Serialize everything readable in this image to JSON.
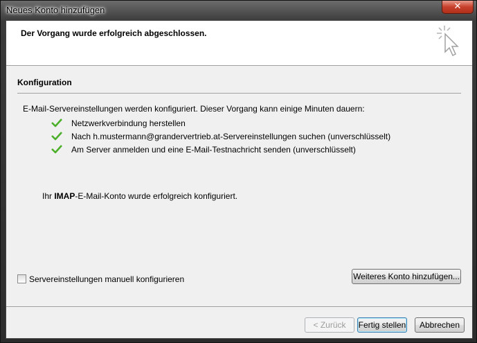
{
  "window": {
    "title": "Neues Konto hinzufügen",
    "close_label": "✕"
  },
  "header": {
    "message": "Der Vorgang wurde erfolgreich abgeschlossen."
  },
  "section": {
    "title": "Konfiguration"
  },
  "description": "E-Mail-Servereinstellungen werden konfiguriert. Dieser Vorgang kann einige Minuten dauern:",
  "steps": [
    {
      "label": "Netzwerkverbindung herstellen",
      "status": "done"
    },
    {
      "label": "Nach h.mustermann@grandervertrieb.at-Servereinstellungen suchen (unverschlüsselt)",
      "status": "done"
    },
    {
      "label": "Am Server anmelden und eine E-Mail-Testnachricht senden (unverschlüsselt)",
      "status": "done"
    }
  ],
  "result": {
    "prefix": "Ihr ",
    "account_type": "IMAP",
    "suffix": "-E-Mail-Konto wurde erfolgreich konfiguriert."
  },
  "manual_config": {
    "label": "Servereinstellungen manuell konfigurieren",
    "checked": false
  },
  "buttons": {
    "add_another": "Weiteres Konto hinzufügen...",
    "back": "< Zurück",
    "finish": "Fertig stellen",
    "cancel": "Abbrechen"
  },
  "colors": {
    "check": "#4caf2a",
    "close_button": "#c7402b"
  },
  "icons": {
    "check": "check-icon",
    "header": "cursor-sparkle-icon",
    "close": "close-icon"
  }
}
